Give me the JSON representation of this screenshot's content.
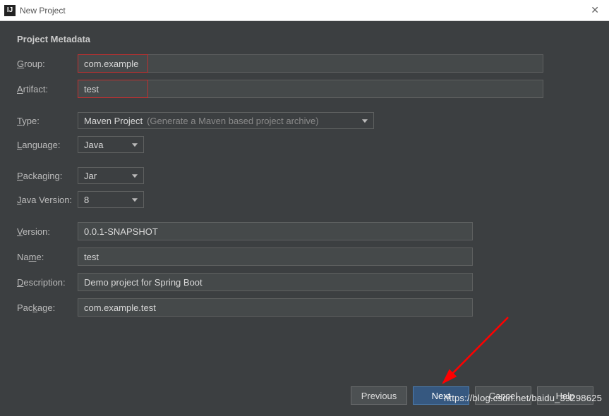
{
  "titlebar": {
    "title": "New Project"
  },
  "section": {
    "title": "Project Metadata"
  },
  "labels": {
    "group": "Group:",
    "group_u": "G",
    "artifact": "Artifact:",
    "artifact_u": "A",
    "type": "Type:",
    "type_u": "T",
    "language": "Language:",
    "language_u": "L",
    "packaging": "Packaging:",
    "packaging_u": "P",
    "java_version": "Java Version:",
    "java_version_u": "J",
    "version": "Version:",
    "version_u": "V",
    "name": "Name:",
    "name_u": "m",
    "description": "Description:",
    "description_u": "D",
    "package": "Package:",
    "package_u": "k"
  },
  "values": {
    "group": "com.example",
    "artifact": "test",
    "type": "Maven Project",
    "type_hint": "(Generate a Maven based project archive)",
    "language": "Java",
    "packaging": "Jar",
    "java_version": "8",
    "version": "0.0.1-SNAPSHOT",
    "name": "test",
    "description": "Demo project for Spring Boot",
    "package": "com.example.test"
  },
  "buttons": {
    "previous": "Previous",
    "next": "Next",
    "cancel": "Cancel",
    "help": "Help"
  },
  "watermark": "https://blog.csdn.net/baidu_39298625"
}
